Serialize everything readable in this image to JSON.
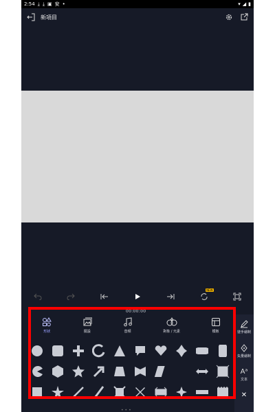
{
  "status": {
    "time": "2:54",
    "glyph": "安"
  },
  "app": {
    "title": "新項目"
  },
  "player": {
    "timecode": "00:00:00",
    "new_badge": "NEW"
  },
  "tabs": [
    {
      "label": "形狀",
      "icon": "shapes-icon"
    },
    {
      "label": "擺設",
      "icon": "photo-stack-icon"
    },
    {
      "label": "音頻",
      "icon": "music-icon"
    },
    {
      "label": "對象 / 元素",
      "icon": "elements-icon"
    },
    {
      "label": "模板",
      "icon": "template-icon"
    }
  ],
  "side_panel": [
    {
      "label": "徒手繪制",
      "icon": "pen-icon"
    },
    {
      "label": "矢量繪制",
      "icon": "vector-pen-icon"
    },
    {
      "label": "文本",
      "icon": "text-icon"
    },
    {
      "label": "",
      "icon": "close-icon"
    }
  ],
  "shapes": [
    "circle",
    "rounded-square",
    "plus",
    "arc",
    "triangle",
    "speech-bubble",
    "heart",
    "diamond-burst",
    "badge-wide",
    "tall-label",
    "pacman",
    "hexagon",
    "star-rounded",
    "arrow",
    "trapezoid",
    "star-banner",
    "parallelogram",
    "crescent",
    "arrow-double",
    "frame",
    "square-small",
    "star",
    "line",
    "slash",
    "frame-corner",
    "x-shape",
    "double-arrow",
    "sparkle",
    "ribbon",
    "zigzag"
  ],
  "colors": {
    "bg": "#161a27",
    "preview": "#d9d9d9",
    "shape": "#c9ccd4",
    "accent": "#9aa0ff",
    "highlight": "#ff0000"
  }
}
